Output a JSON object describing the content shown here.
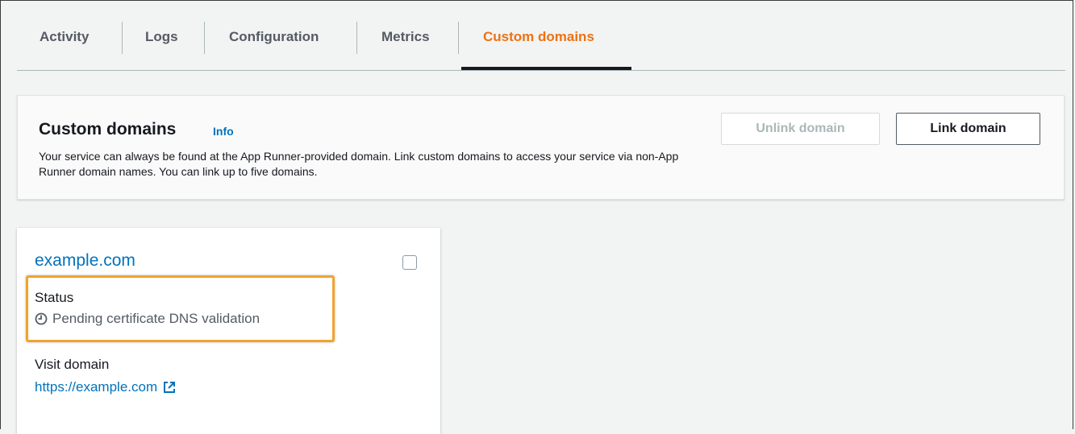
{
  "tabs": [
    {
      "label": "Activity"
    },
    {
      "label": "Logs"
    },
    {
      "label": "Configuration"
    },
    {
      "label": "Metrics"
    },
    {
      "label": "Custom domains"
    }
  ],
  "active_tab": "Custom domains",
  "panel": {
    "title": "Custom domains",
    "info": "Info",
    "description": "Your service can always be found at the App Runner-provided domain. Link custom domains to access your service via non-App Runner domain names. You can link up to five domains.",
    "unlink_label": "Unlink domain",
    "link_label": "Link domain"
  },
  "card": {
    "domain": "example.com",
    "status_label": "Status",
    "status_value": "Pending certificate DNS validation",
    "status_icon": "clock-icon",
    "visit_label": "Visit domain",
    "visit_url": "https://example.com",
    "visit_icon": "external-link-icon"
  },
  "colors": {
    "accent_tab": "#ec7211",
    "link": "#0073bb",
    "highlight": "#f0a330"
  }
}
